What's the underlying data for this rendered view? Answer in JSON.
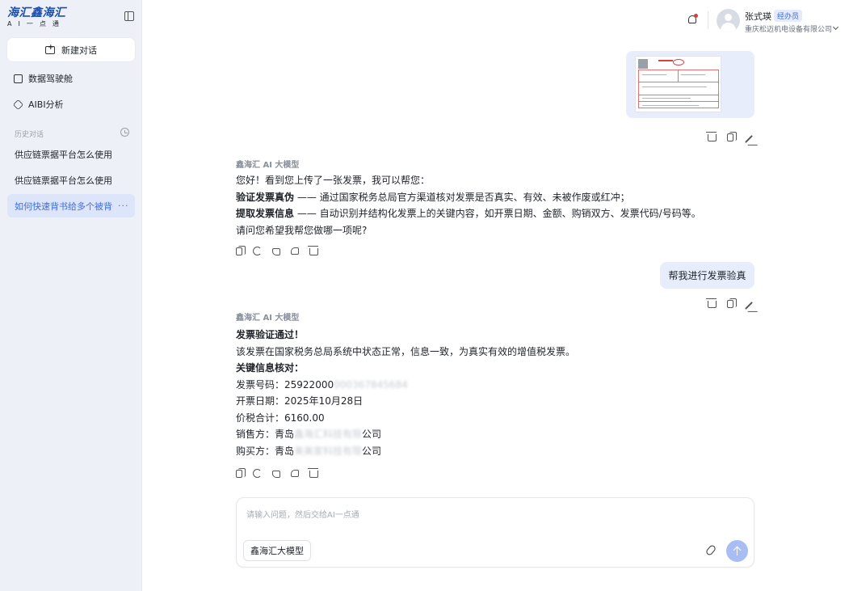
{
  "brand": {
    "logo_text": "海汇鑫海汇",
    "logo_sub": "AI一点通"
  },
  "sidebar": {
    "new_chat_label": "新建对话",
    "nav": [
      {
        "label": "数据驾驶舱",
        "icon": "dashboard-icon"
      },
      {
        "label": "AIBI分析",
        "icon": "cube-icon"
      }
    ],
    "history_label": "历史对话",
    "history": [
      {
        "label": "供应链票据平台怎么使用"
      },
      {
        "label": "供应链票据平台怎么使用"
      },
      {
        "label": "如何快速背书给多个被背书人"
      }
    ],
    "more_label": "···"
  },
  "header": {
    "user_name": "张式瑛",
    "role": "经办员",
    "company": "重庆松迈机电设备有限公司"
  },
  "chat": {
    "ai_label_1": "鑫海汇 AI 大模型",
    "ai_reply_1": {
      "line1": "您好！看到您上传了一张发票，我可以帮您：",
      "line2_bold": "验证发票真伪",
      "line2_rest": " —— 通过国家税务总局官方渠道核对发票是否真实、有效、未被作废或红冲；",
      "line3_bold": "提取发票信息",
      "line3_rest": " —— 自动识别并结构化发票上的关键内容，如开票日期、金额、购销双方、发票代码/号码等。",
      "line4": "请问您希望我帮您做哪一项呢?"
    },
    "user_msg": "帮我进行发票验真",
    "ai_label_2": "鑫海汇 AI 大模型",
    "ai_reply_2": {
      "title": "发票验证通过！",
      "line1": "该发票在国家税务总局系统中状态正常，信息一致，为真实有效的增值税发票。",
      "key_title": "关键信息核对：",
      "invoice_no_label": "发票号码：",
      "invoice_no": "25922000",
      "invoice_no_masked": "000367845684",
      "date_label": "开票日期：",
      "date": "2025年10月28日",
      "total_label": "价税合计：",
      "total": "6160.00",
      "seller_label": "销售方：",
      "seller_prefix": "青岛",
      "seller_masked": "鑫海汇科技有限",
      "seller_suffix": "公司",
      "buyer_label": "购买方：",
      "buyer_prefix": "青岛",
      "buyer_masked": "美美家科技有限",
      "buyer_suffix": "公司"
    }
  },
  "input": {
    "placeholder": "请输入问题，然后交给AI一点通",
    "model_label": "鑫海汇大模型"
  }
}
